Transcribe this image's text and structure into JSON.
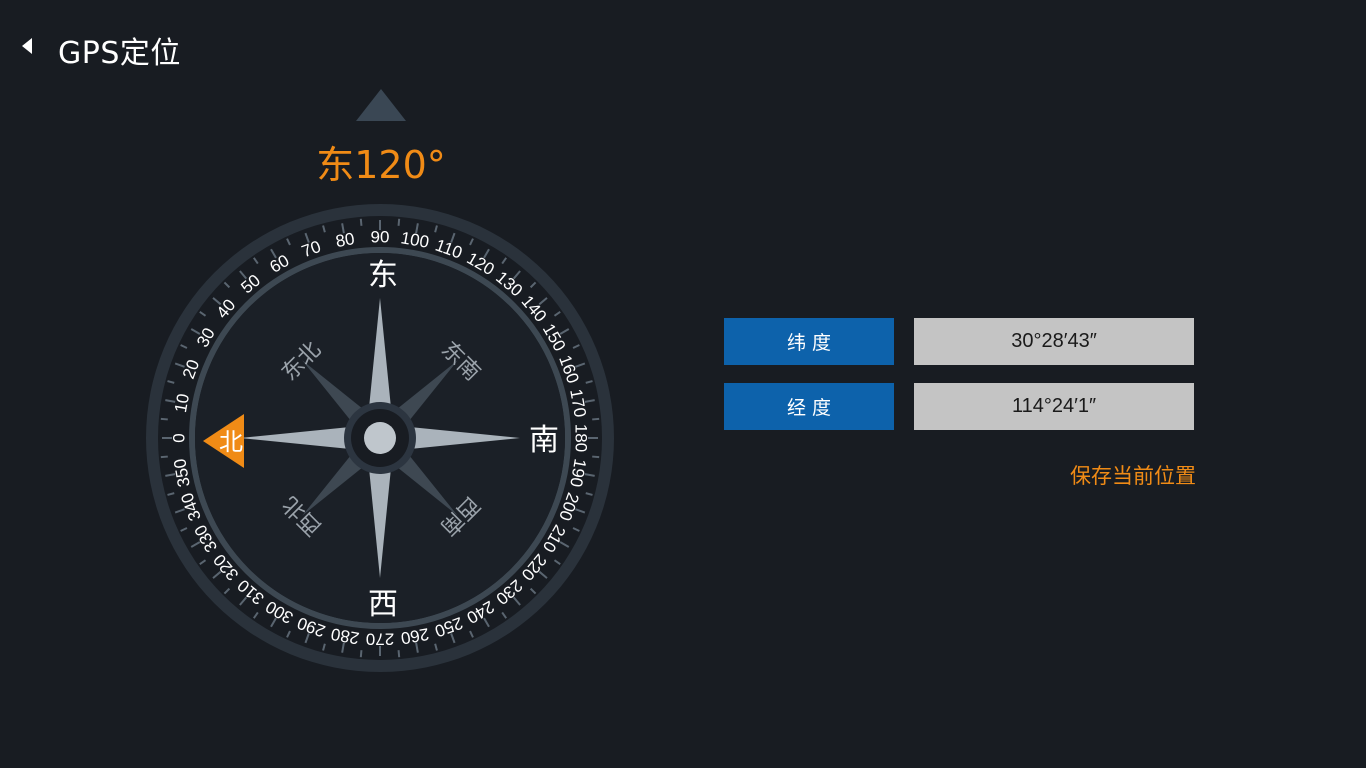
{
  "app": {
    "title": "GPS定位"
  },
  "colors": {
    "background": "#181c22",
    "accent_orange": "#f08b16",
    "label_blue": "#0d62ab",
    "value_gray": "#c4c4c4",
    "ring_gray": "#3d4852"
  },
  "icons": {
    "back": "triangle-left-icon",
    "heading_pointer": "triangle-up-icon",
    "north_marker": "triangle-left-icon"
  },
  "heading": {
    "text": "东120°",
    "direction": "东",
    "degrees": 120
  },
  "compass": {
    "scale_labels": [
      "0",
      "10",
      "20",
      "30",
      "40",
      "50",
      "60",
      "70",
      "80",
      "90",
      "100",
      "110",
      "120",
      "130",
      "140",
      "150",
      "160",
      "170",
      "180",
      "190",
      "200",
      "210",
      "220",
      "230",
      "240",
      "250",
      "260",
      "270",
      "280",
      "290",
      "300",
      "310",
      "320",
      "330",
      "340",
      "350"
    ],
    "cardinals": {
      "north": "北",
      "east": "东",
      "south": "南",
      "west": "西"
    },
    "intercardinals": {
      "northeast": "东北",
      "southeast": "东南",
      "southwest": "西南",
      "northwest": "西北"
    }
  },
  "location": {
    "latitude_label": "纬 度",
    "latitude_value": "30°28′43″",
    "longitude_label": "经 度",
    "longitude_value": "114°24′1″"
  },
  "actions": {
    "save_label": "保存当前位置"
  }
}
